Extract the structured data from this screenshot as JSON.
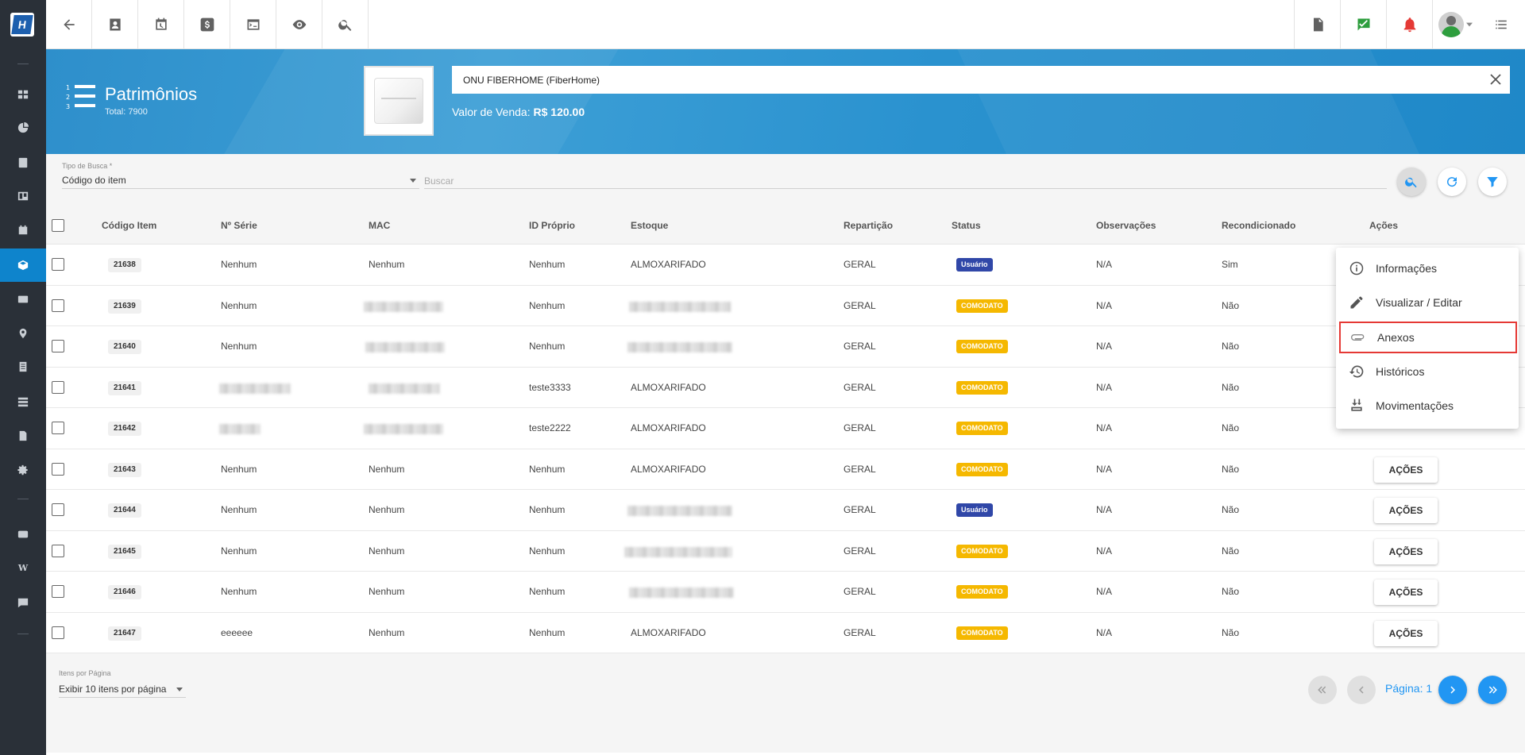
{
  "header": {
    "title": "Patrimônios",
    "total": "Total: 7900",
    "search_value": "ONU FIBERHOME  (FiberHome)",
    "price_label": "Valor de Venda:",
    "price_value": "R$ 120.00"
  },
  "filter": {
    "type_label": "Tipo de Busca *",
    "type_value": "Código do item",
    "search_placeholder": "Buscar"
  },
  "table": {
    "columns": [
      "Código Item",
      "Nº Série",
      "MAC",
      "ID Próprio",
      "Estoque",
      "Repartição",
      "Status",
      "Observações",
      "Recondicionado",
      "Ações"
    ],
    "rows": [
      {
        "code": "21638",
        "serie": "Nenhum",
        "mac": "Nenhum",
        "id": "Nenhum",
        "estoque": "ALMOXARIFADO",
        "reparticao": "GERAL",
        "status": "Usuário",
        "obs": "N/A",
        "recond": "Sim",
        "acoes": ""
      },
      {
        "code": "21639",
        "serie": "Nenhum",
        "mac": "",
        "id": "Nenhum",
        "estoque": "",
        "reparticao": "GERAL",
        "status": "COMODATO",
        "obs": "N/A",
        "recond": "Não",
        "acoes": ""
      },
      {
        "code": "21640",
        "serie": "Nenhum",
        "mac": "",
        "id": "Nenhum",
        "estoque": "",
        "reparticao": "GERAL",
        "status": "COMODATO",
        "obs": "N/A",
        "recond": "Não",
        "acoes": ""
      },
      {
        "code": "21641",
        "serie": "",
        "mac": "",
        "id": "teste3333",
        "estoque": "ALMOXARIFADO",
        "reparticao": "GERAL",
        "status": "COMODATO",
        "obs": "N/A",
        "recond": "Não",
        "acoes": ""
      },
      {
        "code": "21642",
        "serie": "",
        "mac": "",
        "id": "teste2222",
        "estoque": "ALMOXARIFADO",
        "reparticao": "GERAL",
        "status": "COMODATO",
        "obs": "N/A",
        "recond": "Não",
        "acoes": ""
      },
      {
        "code": "21643",
        "serie": "Nenhum",
        "mac": "Nenhum",
        "id": "Nenhum",
        "estoque": "ALMOXARIFADO",
        "reparticao": "GERAL",
        "status": "COMODATO",
        "obs": "N/A",
        "recond": "Não",
        "acoes": "AÇÕES"
      },
      {
        "code": "21644",
        "serie": "Nenhum",
        "mac": "Nenhum",
        "id": "Nenhum",
        "estoque": "",
        "reparticao": "GERAL",
        "status": "Usuário",
        "obs": "N/A",
        "recond": "Não",
        "acoes": "AÇÕES"
      },
      {
        "code": "21645",
        "serie": "Nenhum",
        "mac": "Nenhum",
        "id": "Nenhum",
        "estoque": "",
        "reparticao": "GERAL",
        "status": "COMODATO",
        "obs": "N/A",
        "recond": "Não",
        "acoes": "AÇÕES"
      },
      {
        "code": "21646",
        "serie": "Nenhum",
        "mac": "Nenhum",
        "id": "Nenhum",
        "estoque": "",
        "reparticao": "GERAL",
        "status": "COMODATO",
        "obs": "N/A",
        "recond": "Não",
        "acoes": "AÇÕES"
      },
      {
        "code": "21647",
        "serie": "eeeeee",
        "mac": "Nenhum",
        "id": "Nenhum",
        "estoque": "ALMOXARIFADO",
        "reparticao": "GERAL",
        "status": "COMODATO",
        "obs": "N/A",
        "recond": "Não",
        "acoes": "AÇÕES"
      }
    ]
  },
  "menu": {
    "items": [
      "Informações",
      "Visualizar / Editar",
      "Anexos",
      "Históricos",
      "Movimentações"
    ]
  },
  "footer": {
    "per_page_label": "Itens por Página",
    "per_page_value": "Exibir 10 itens por página",
    "page_label": "Página: 1"
  },
  "colors": {
    "accent": "#2196f3",
    "rail": "#2a3038",
    "usuario": "#3047a8",
    "comodato": "#f5b800",
    "highlight": "#e53935"
  }
}
